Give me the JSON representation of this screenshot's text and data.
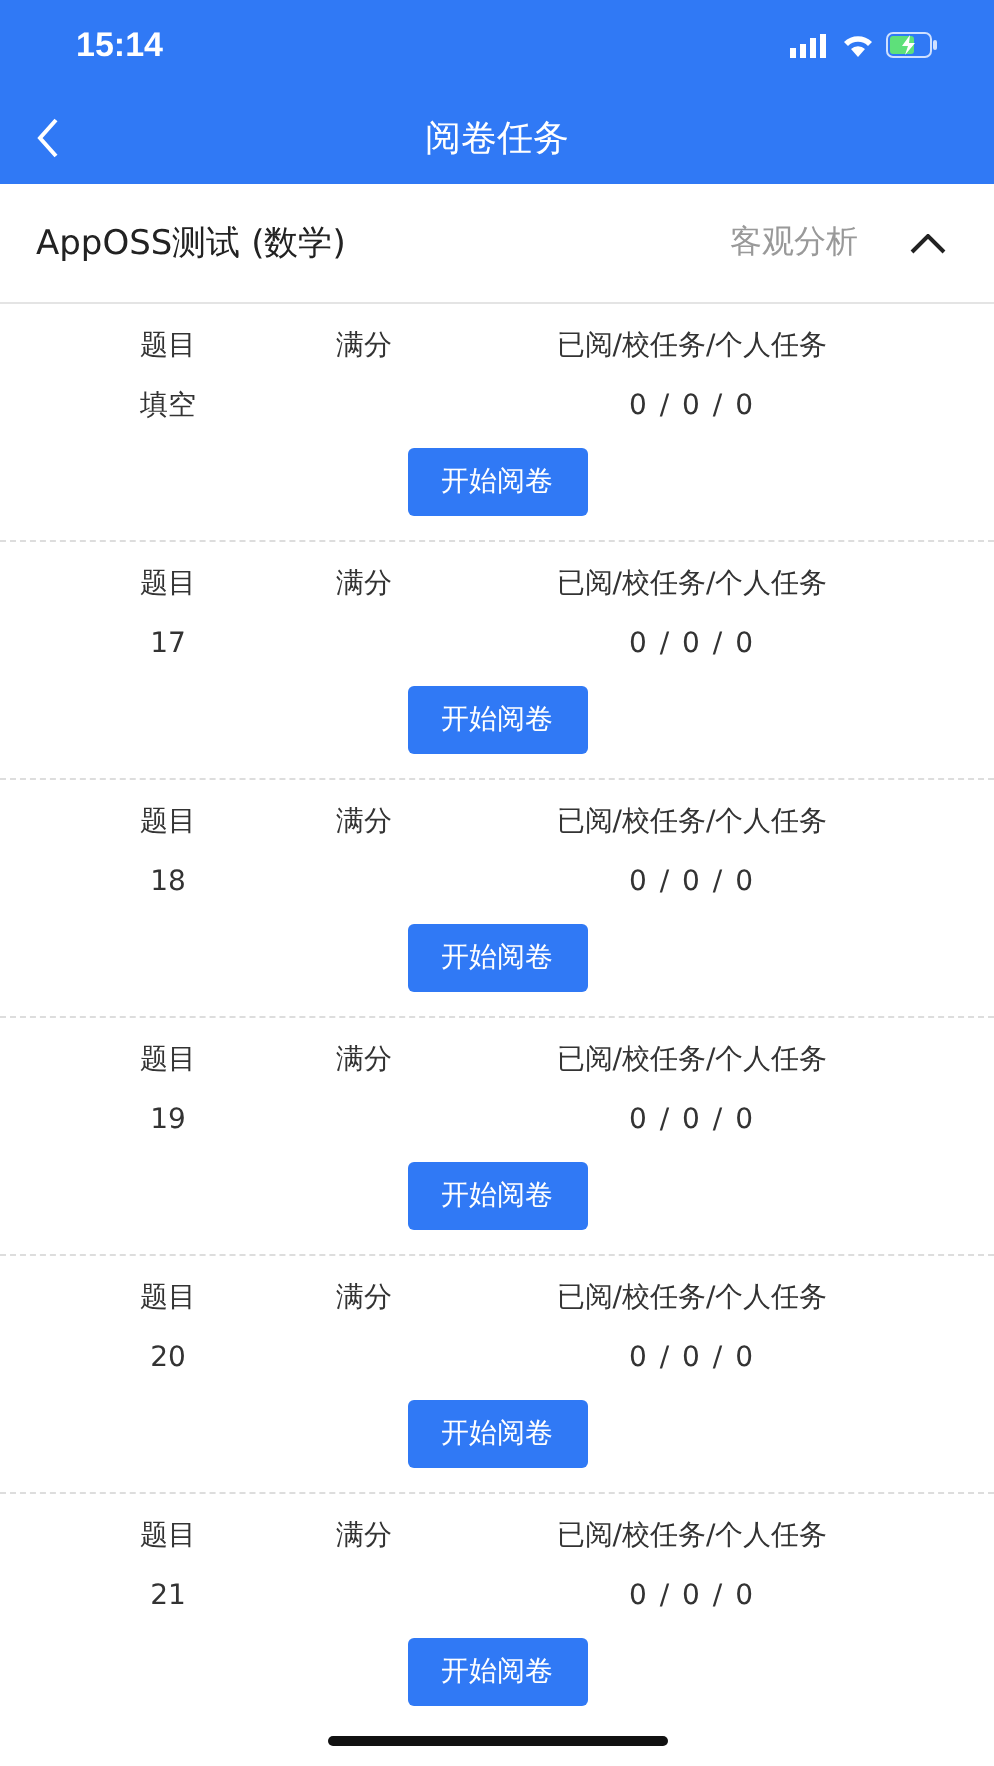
{
  "status_bar": {
    "time": "15:14"
  },
  "nav": {
    "title": "阅卷任务"
  },
  "exam": {
    "title": "AppOSS测试 (数学)",
    "action": "客观分析",
    "expanded": true
  },
  "tasks": [
    {
      "headers": [
        "题目",
        "满分",
        "已阅/校任务/个人任务"
      ],
      "question": "填空",
      "progress": "0 / 0 / 0",
      "button": "开始阅卷"
    },
    {
      "headers": [
        "题目",
        "满分",
        "已阅/校任务/个人任务"
      ],
      "question": "17",
      "progress": "0 / 0 / 0",
      "button": "开始阅卷"
    },
    {
      "headers": [
        "题目",
        "满分",
        "已阅/校任务/个人任务"
      ],
      "question": "18",
      "progress": "0 / 0 / 0",
      "button": "开始阅卷"
    },
    {
      "headers": [
        "题目",
        "满分",
        "已阅/校任务/个人任务"
      ],
      "question": "19",
      "progress": "0 / 0 / 0",
      "button": "开始阅卷"
    },
    {
      "headers": [
        "题目",
        "满分",
        "已阅/校任务/个人任务"
      ],
      "question": "20",
      "progress": "0 / 0 / 0",
      "button": "开始阅卷"
    },
    {
      "headers": [
        "题目",
        "满分",
        "已阅/校任务/个人任务"
      ],
      "question": "21",
      "progress": "0 / 0 / 0",
      "button": "开始阅卷"
    }
  ]
}
